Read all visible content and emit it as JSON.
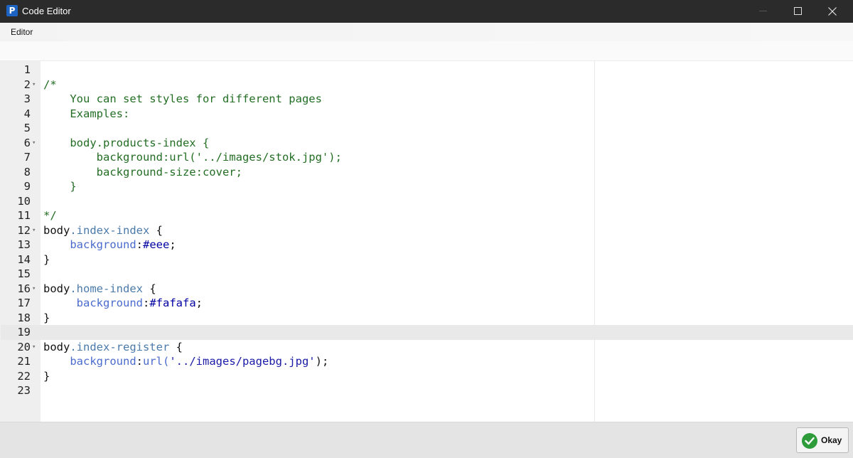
{
  "window": {
    "logo_letter": "P",
    "title": "Code Editor"
  },
  "menu": {
    "items": [
      "Editor"
    ]
  },
  "editor": {
    "active_line": 19,
    "lines": [
      {
        "n": "1",
        "fold": false,
        "tokens": []
      },
      {
        "n": "2",
        "fold": true,
        "tokens": [
          {
            "t": "/*",
            "c": "comment"
          }
        ]
      },
      {
        "n": "3",
        "fold": false,
        "tokens": [
          {
            "t": "    You can set styles for different pages",
            "c": "comment"
          }
        ]
      },
      {
        "n": "4",
        "fold": false,
        "tokens": [
          {
            "t": "    Examples:",
            "c": "comment"
          }
        ]
      },
      {
        "n": "5",
        "fold": false,
        "tokens": []
      },
      {
        "n": "6",
        "fold": true,
        "tokens": [
          {
            "t": "    body.products-index {",
            "c": "comment"
          }
        ]
      },
      {
        "n": "7",
        "fold": false,
        "tokens": [
          {
            "t": "        background:url('../images/stok.jpg');",
            "c": "comment"
          }
        ]
      },
      {
        "n": "8",
        "fold": false,
        "tokens": [
          {
            "t": "        background-size:cover;",
            "c": "comment"
          }
        ]
      },
      {
        "n": "9",
        "fold": false,
        "tokens": [
          {
            "t": "    }",
            "c": "comment"
          }
        ]
      },
      {
        "n": "10",
        "fold": false,
        "tokens": []
      },
      {
        "n": "11",
        "fold": false,
        "tokens": [
          {
            "t": "*/",
            "c": "comment"
          }
        ]
      },
      {
        "n": "12",
        "fold": true,
        "tokens": [
          {
            "t": "body",
            "c": "plain"
          },
          {
            "t": ".index-index",
            "c": "class"
          },
          {
            "t": " {",
            "c": "plain"
          }
        ]
      },
      {
        "n": "13",
        "fold": false,
        "tokens": [
          {
            "t": "    ",
            "c": "plain"
          },
          {
            "t": "background",
            "c": "prop"
          },
          {
            "t": ":",
            "c": "plain"
          },
          {
            "t": "#eee",
            "c": "value"
          },
          {
            "t": ";",
            "c": "plain"
          }
        ]
      },
      {
        "n": "14",
        "fold": false,
        "tokens": [
          {
            "t": "}",
            "c": "plain"
          }
        ]
      },
      {
        "n": "15",
        "fold": false,
        "tokens": []
      },
      {
        "n": "16",
        "fold": true,
        "tokens": [
          {
            "t": "body",
            "c": "plain"
          },
          {
            "t": ".home-index",
            "c": "class"
          },
          {
            "t": " {",
            "c": "plain"
          }
        ]
      },
      {
        "n": "17",
        "fold": false,
        "tokens": [
          {
            "t": "     ",
            "c": "plain"
          },
          {
            "t": "background",
            "c": "prop"
          },
          {
            "t": ":",
            "c": "plain"
          },
          {
            "t": "#fafafa",
            "c": "value"
          },
          {
            "t": ";",
            "c": "plain"
          }
        ]
      },
      {
        "n": "18",
        "fold": false,
        "tokens": [
          {
            "t": "}",
            "c": "plain"
          }
        ]
      },
      {
        "n": "19",
        "fold": false,
        "tokens": []
      },
      {
        "n": "20",
        "fold": true,
        "tokens": [
          {
            "t": "body",
            "c": "plain"
          },
          {
            "t": ".index-register",
            "c": "class"
          },
          {
            "t": " {",
            "c": "plain"
          }
        ]
      },
      {
        "n": "21",
        "fold": false,
        "tokens": [
          {
            "t": "    ",
            "c": "plain"
          },
          {
            "t": "background",
            "c": "prop"
          },
          {
            "t": ":",
            "c": "plain"
          },
          {
            "t": "url(",
            "c": "prop"
          },
          {
            "t": "'../images/pagebg.jpg'",
            "c": "string"
          },
          {
            "t": ");",
            "c": "plain"
          }
        ]
      },
      {
        "n": "22",
        "fold": false,
        "tokens": [
          {
            "t": "}",
            "c": "plain"
          }
        ]
      },
      {
        "n": "23",
        "fold": false,
        "tokens": []
      }
    ]
  },
  "footer": {
    "okay_label": "Okay"
  },
  "colors": {
    "titlebar": "#2b2b2b",
    "comment": "#236e24",
    "selector_class": "#4a7aaa",
    "property": "#4a6bcd",
    "value": "#0000a2",
    "okay_icon": "#2e9c3b"
  }
}
